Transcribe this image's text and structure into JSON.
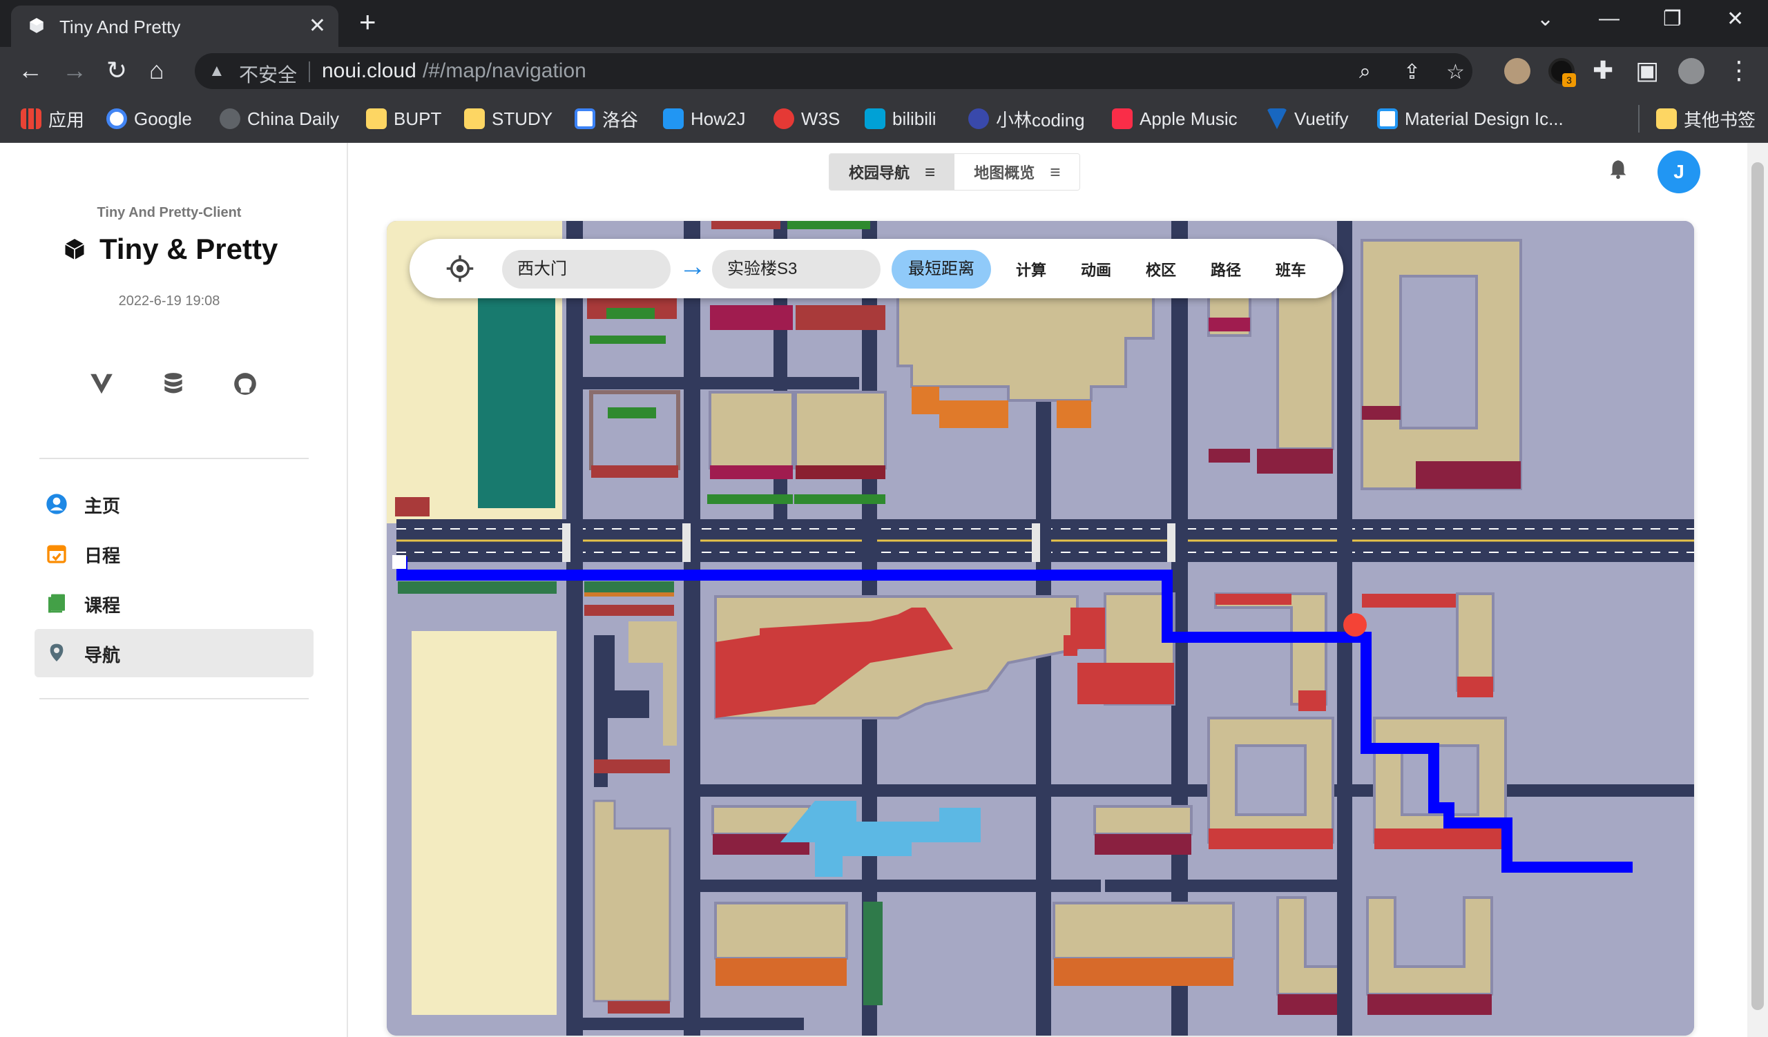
{
  "browser": {
    "tab_title": "Tiny And Pretty",
    "tab_close": "✕",
    "new_tab": "+",
    "insecure_label": "不安全",
    "url_domain": "noui.cloud",
    "url_path": "/#/map/navigation",
    "extension_badge": "3",
    "bookmarks": [
      {
        "label": "应用",
        "color": "#ea4335"
      },
      {
        "label": "Google",
        "color": "#4285f4"
      },
      {
        "label": "China Daily",
        "color": "#1a73e8"
      },
      {
        "label": "BUPT",
        "color": "#fdd663"
      },
      {
        "label": "STUDY",
        "color": "#fdd663"
      },
      {
        "label": "洛谷",
        "color": "#3b82f6"
      },
      {
        "label": "How2J",
        "color": "#2196f3"
      },
      {
        "label": "W3S",
        "color": "#e53935"
      },
      {
        "label": "bilibili",
        "color": "#00a1d6"
      },
      {
        "label": "小林coding",
        "color": "#3949ab"
      },
      {
        "label": "Apple Music",
        "color": "#fa2d48"
      },
      {
        "label": "Vuetify",
        "color": "#1867c0"
      },
      {
        "label": "Material Design Ic...",
        "color": "#2196f3"
      },
      {
        "label": "其他书签",
        "color": "#fdd663"
      }
    ]
  },
  "sidebar": {
    "subtitle": "Tiny And Pretty-Client",
    "brand": "Tiny & Pretty",
    "date": "2022-6-19 19:08",
    "nav": [
      {
        "label": "主页",
        "icon": "account-circle-icon",
        "color": "#1e88e5"
      },
      {
        "label": "日程",
        "icon": "calendar-icon",
        "color": "#fb8c00"
      },
      {
        "label": "课程",
        "icon": "book-icon",
        "color": "#43a047"
      },
      {
        "label": "导航",
        "icon": "map-marker-icon",
        "color": "#546e7a"
      }
    ]
  },
  "header": {
    "tabs": [
      {
        "label": "校园导航"
      },
      {
        "label": "地图概览"
      }
    ],
    "avatar_letter": "J"
  },
  "search": {
    "from": "西大门",
    "to": "实验楼S3",
    "mode": "最短距离",
    "actions": [
      "计算",
      "动画",
      "校区",
      "路径",
      "班车"
    ]
  },
  "colors": {
    "route": "#0000ff",
    "destination_marker": "#f44336",
    "accent": "#2196f3"
  }
}
